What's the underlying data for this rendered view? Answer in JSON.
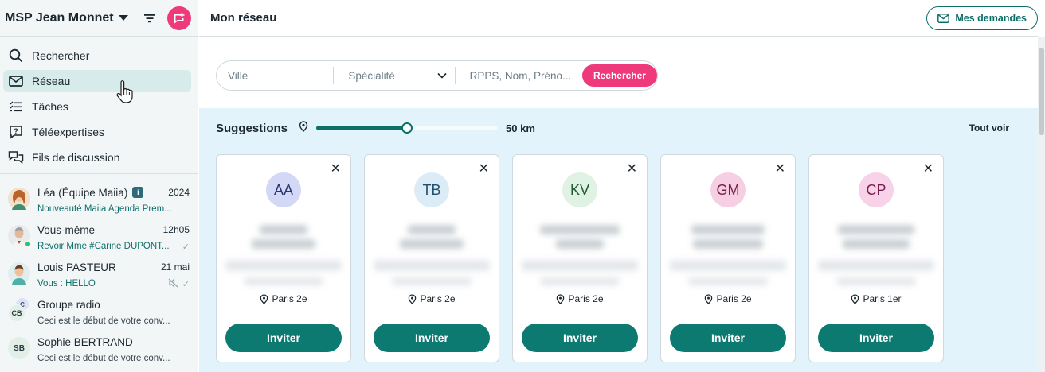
{
  "sidebar": {
    "org_name": "MSP Jean Monnet",
    "nav": [
      {
        "label": "Rechercher",
        "icon": "search-icon"
      },
      {
        "label": "Réseau",
        "icon": "mail-icon",
        "active": true
      },
      {
        "label": "Tâches",
        "icon": "tasks-icon"
      },
      {
        "label": "Téléexpertises",
        "icon": "question-bubble-icon"
      },
      {
        "label": "Fils de discussion",
        "icon": "chat-bubbles-icon"
      }
    ],
    "conversations": [
      {
        "name": "Léa (Équipe Maiia)",
        "time": "2024",
        "message": "Nouveauté Maiia Agenda Prem...",
        "badge": "i"
      },
      {
        "name": "Vous-même",
        "time": "12h05",
        "message": "Revoir Mme #Carine DUPONT..."
      },
      {
        "name": "Louis PASTEUR",
        "time": "21 mai",
        "message": "Vous : HELLO"
      },
      {
        "name": "Groupe radio",
        "time": "",
        "message": "Ceci est le début de votre conv...",
        "initials": "CB",
        "initials2": "C"
      },
      {
        "name": "Sophie BERTRAND",
        "time": "",
        "message": "Ceci est le début de votre conv...",
        "initials": "SB"
      }
    ]
  },
  "main": {
    "title": "Mon réseau",
    "mes_demandes": "Mes demandes",
    "search": {
      "ville_placeholder": "Ville",
      "specialite_placeholder": "Spécialité",
      "rpps_placeholder": "RPPS, Nom, Préno...",
      "button": "Rechercher"
    },
    "suggestions": {
      "title": "Suggestions",
      "distance_label": "50 km",
      "distance_fraction": 0.5,
      "tout_voir": "Tout voir",
      "cards": [
        {
          "initials": "AA",
          "location": "Paris 2e",
          "invite": "Inviter",
          "avatar_bg": "#d3d8f6",
          "avatar_color": "#2a3670"
        },
        {
          "initials": "TB",
          "location": "Paris 2e",
          "invite": "Inviter",
          "avatar_bg": "#dcecf7",
          "avatar_color": "#22506b"
        },
        {
          "initials": "KV",
          "location": "Paris 2e",
          "invite": "Inviter",
          "avatar_bg": "#dff2e4",
          "avatar_color": "#1f5a33"
        },
        {
          "initials": "GM",
          "location": "Paris 2e",
          "invite": "Inviter",
          "avatar_bg": "#f7cfe3",
          "avatar_color": "#7a1f4c"
        },
        {
          "initials": "CP",
          "location": "Paris 1er",
          "invite": "Inviter",
          "avatar_bg": "#f8d2e8",
          "avatar_color": "#7a1f4c"
        }
      ]
    }
  },
  "colors": {
    "accent": "#ee3a7a",
    "primary": "#0d7a72",
    "active_nav": "#d7ecea",
    "suggestions_bg": "#e3f3fb"
  }
}
